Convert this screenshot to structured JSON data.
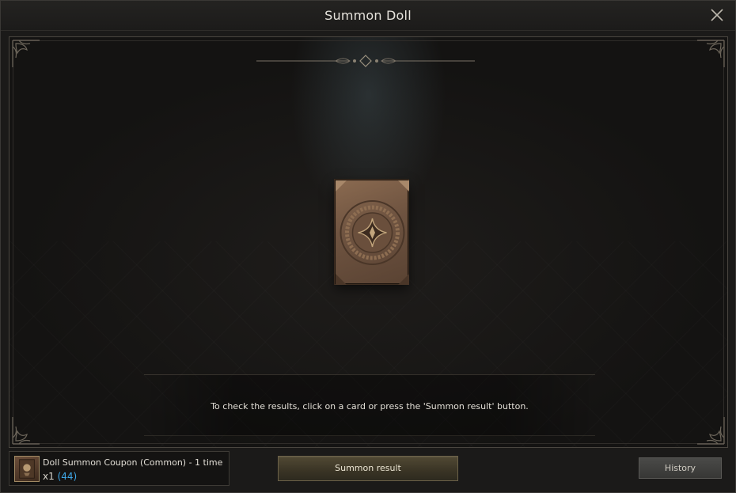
{
  "window": {
    "title": "Summon Doll",
    "close_icon": "close-icon"
  },
  "main": {
    "message": "To check the results, click on a card or press the 'Summon result' button.",
    "card": {
      "state": "face-down",
      "icon": "star-emblem-icon"
    }
  },
  "footer": {
    "coupon": {
      "name": "Doll Summon Coupon (Common) - 1 time",
      "quantity": "x1",
      "owned": "(44)",
      "owned_color": "#3fa7e6"
    },
    "summon_button": "Summon result",
    "history_button": "History"
  }
}
